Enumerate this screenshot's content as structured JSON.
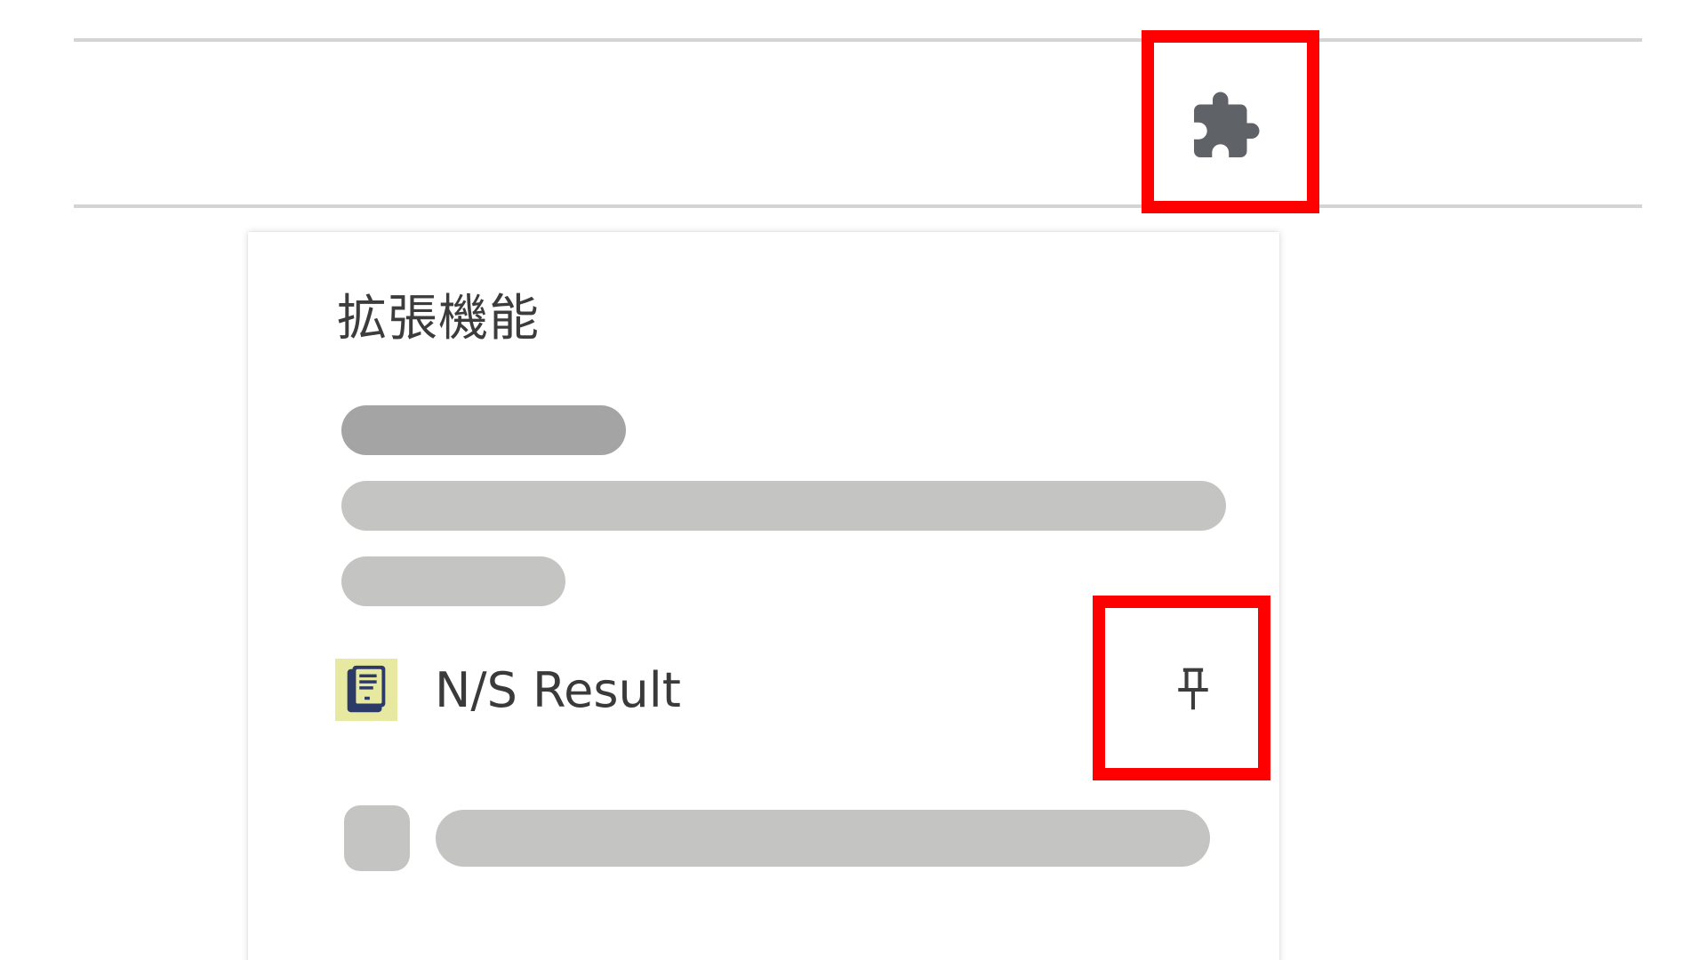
{
  "toolbar": {
    "extensions_icon": "puzzle-piece-icon",
    "icon_color": "#5f6368"
  },
  "extensions_popup": {
    "title": "拡張機能",
    "items": [
      {
        "name": "N/S Result",
        "icon": "document-icon",
        "icon_bg": "#e8e9a0",
        "pin_icon": "pin-icon"
      }
    ]
  },
  "annotations": {
    "highlight_color": "#ff0000"
  }
}
